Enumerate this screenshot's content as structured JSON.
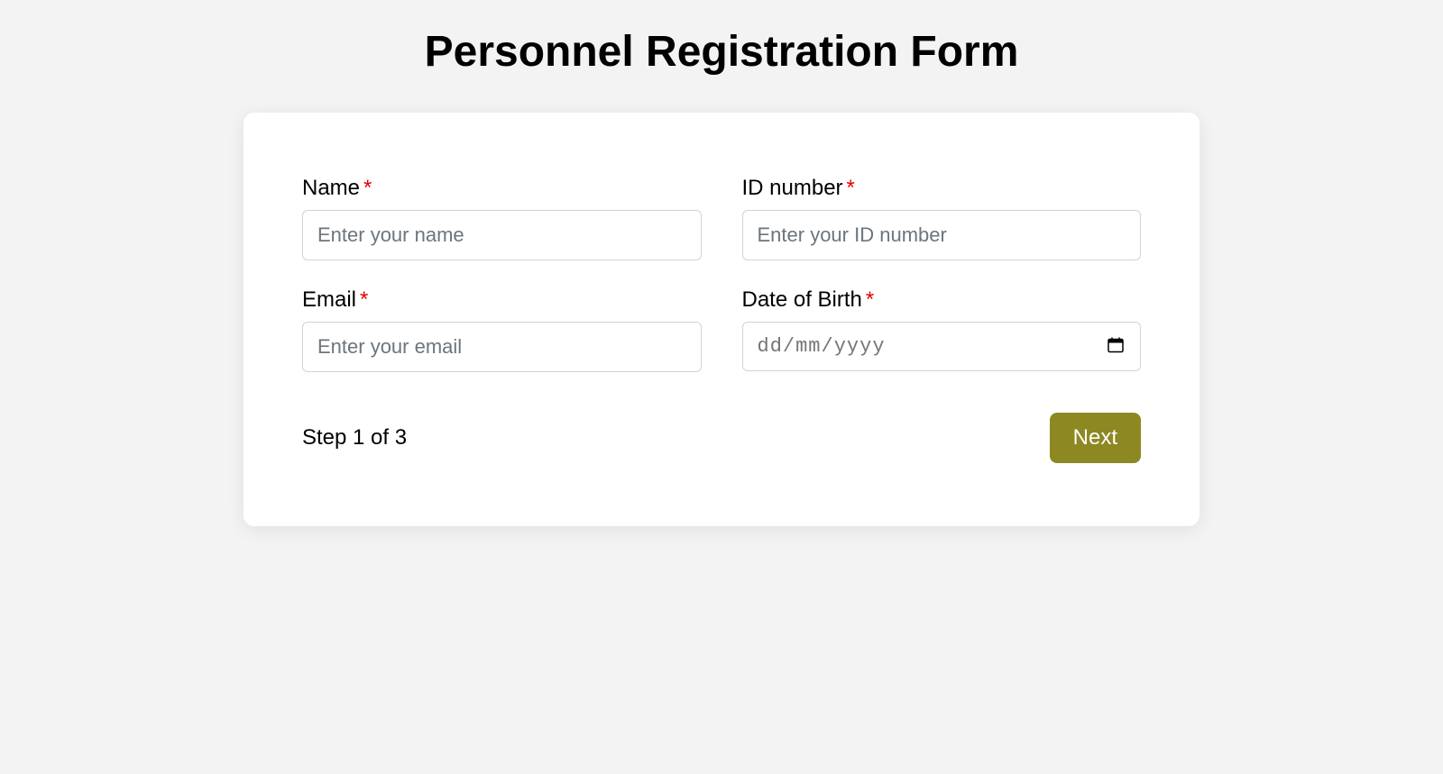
{
  "page": {
    "title": "Personnel Registration Form"
  },
  "form": {
    "fields": {
      "name": {
        "label": "Name",
        "placeholder": "Enter your name",
        "value": ""
      },
      "id_number": {
        "label": "ID number",
        "placeholder": "Enter your ID number",
        "value": ""
      },
      "email": {
        "label": "Email",
        "placeholder": "Enter your email",
        "value": ""
      },
      "dob": {
        "label": "Date of Birth",
        "placeholder": "dd/mm/yyyy",
        "value": ""
      }
    },
    "required_indicator": "*",
    "step_indicator": "Step 1 of 3",
    "next_button_label": "Next"
  }
}
